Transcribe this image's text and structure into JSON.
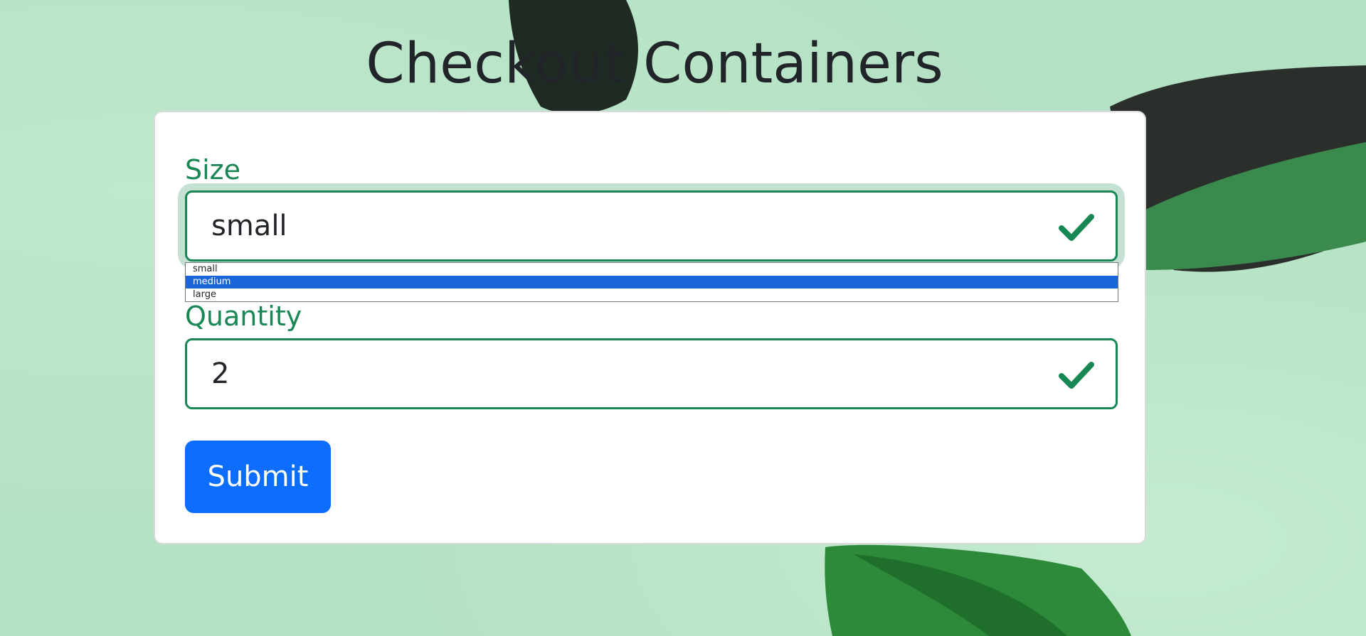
{
  "page": {
    "title": "Checkout Containers"
  },
  "form": {
    "size": {
      "label": "Size",
      "value": "small",
      "options": [
        "small",
        "medium",
        "large"
      ],
      "highlighted_option": "medium"
    },
    "quantity": {
      "label": "Quantity",
      "value": "2"
    },
    "submit_label": "Submit"
  },
  "icons": {
    "valid": "check-icon"
  },
  "colors": {
    "valid": "#198754",
    "primary": "#0d6efd",
    "title": "#212529",
    "option_highlight": "#1a66d9",
    "background": "#b3e1c3"
  }
}
